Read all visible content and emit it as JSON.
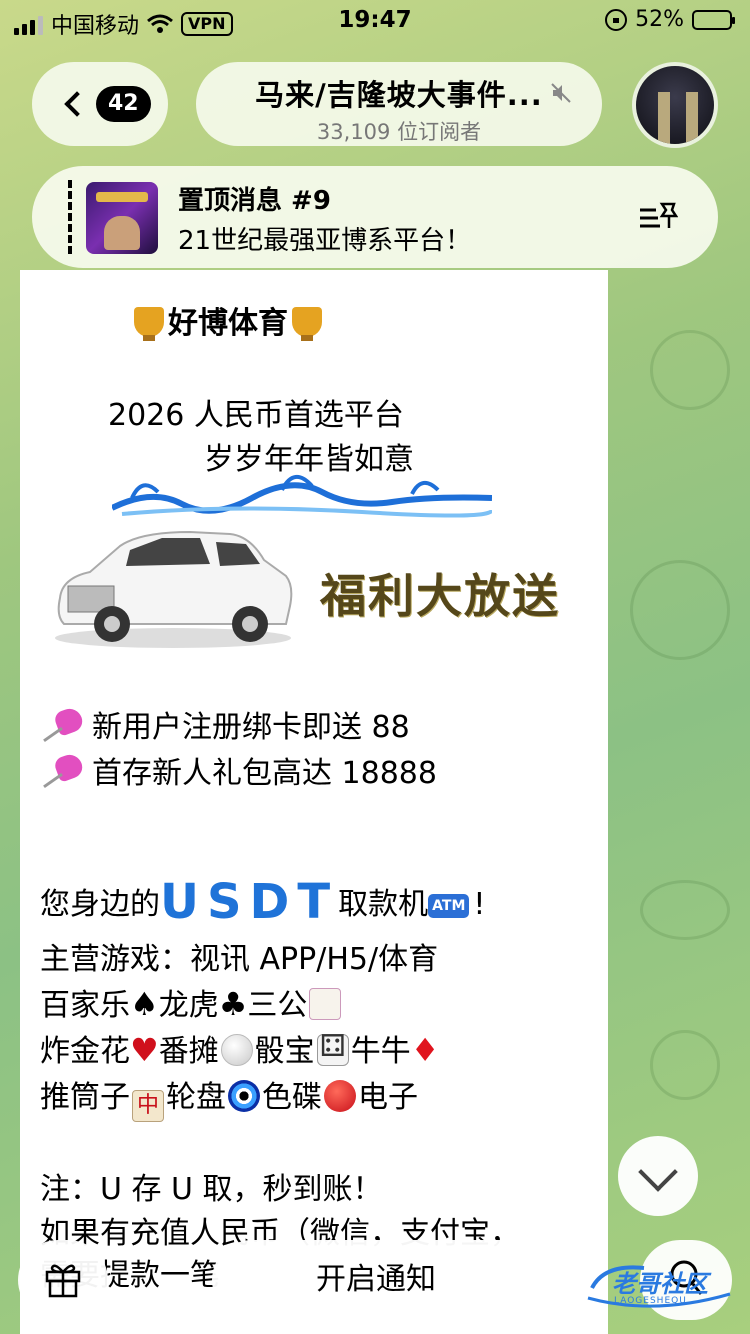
{
  "status_bar": {
    "carrier": "中国移动",
    "vpn": "VPN",
    "time": "19:47",
    "battery": "52%",
    "battery_level": 0.52
  },
  "header": {
    "unread_count": "42",
    "channel_title": "马来/吉隆坡大事件...",
    "subscribers": "33,109 位订阅者"
  },
  "pinned": {
    "title": "置顶消息 #9",
    "text": "21世纪最强亚博系平台！"
  },
  "message": {
    "promo_title": "好博体育",
    "banner_line1": "2026 人民币首选平台",
    "banner_line2": "岁岁年年皆如意",
    "banner_slogan": "福利大放送",
    "bonus1": "新用户注册绑卡即送 88",
    "bonus2": "首存新人礼包高达 18888",
    "atm_prefix": "您身边的",
    "atm_usdt": "USDT",
    "atm_suffix": "取款机",
    "atm_badge": "ATM",
    "atm_end": "!",
    "games_main": "主营游戏：视讯 APP/H5/体育",
    "games_line1": [
      "百家乐",
      "龙虎",
      "三公"
    ],
    "games_line2": [
      "炸金花",
      "番摊",
      "骰宝",
      "牛牛"
    ],
    "games_line3": [
      "推筒子",
      "轮盘",
      "色碟",
      "电子"
    ],
    "mahjong_glyph": "中",
    "note1": "注：U 存 U 取，秒到账！",
    "note2": "如果有充值人民币（微信，支付宝，",
    "note3": "需要提款一笔"
  },
  "bottom": {
    "notify_label": "开启通知"
  },
  "watermark": {
    "text": "老哥社区",
    "sub": "LAOGESHEQU"
  },
  "colors": {
    "usdt_blue": "#1f73d8",
    "slogan": "#55471a",
    "accent_green": "#34c759"
  }
}
